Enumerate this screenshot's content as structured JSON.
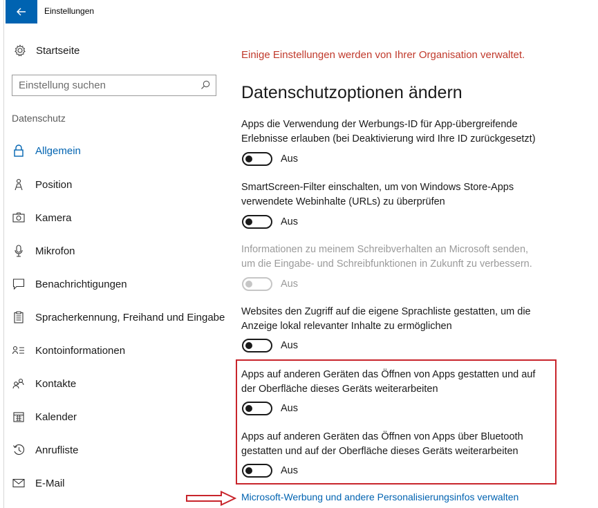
{
  "window": {
    "title": "Einstellungen",
    "back_icon": "back-arrow-icon",
    "accent": "#0063b1"
  },
  "sidebar": {
    "home": {
      "label": "Startseite",
      "icon": "gear-icon"
    },
    "search": {
      "placeholder": "Einstellung suchen",
      "icon": "search-icon"
    },
    "section": "Datenschutz",
    "items": [
      {
        "label": "Allgemein",
        "icon": "lock-icon",
        "active": true
      },
      {
        "label": "Position",
        "icon": "person-location-icon"
      },
      {
        "label": "Kamera",
        "icon": "camera-icon"
      },
      {
        "label": "Mikrofon",
        "icon": "microphone-icon"
      },
      {
        "label": "Benachrichtigungen",
        "icon": "notification-icon"
      },
      {
        "label": "Spracherkennung, Freihand und Eingabe",
        "icon": "clipboard-icon"
      },
      {
        "label": "Kontoinformationen",
        "icon": "account-info-icon"
      },
      {
        "label": "Kontakte",
        "icon": "contacts-icon"
      },
      {
        "label": "Kalender",
        "icon": "calendar-icon"
      },
      {
        "label": "Anrufliste",
        "icon": "call-history-icon"
      },
      {
        "label": "E-Mail",
        "icon": "mail-icon"
      }
    ]
  },
  "main": {
    "org_notice": "Einige Einstellungen werden von Ihrer Organisation verwaltet.",
    "org_notice_color": "#c0392b",
    "heading": "Datenschutzoptionen ändern",
    "settings": [
      {
        "line1": "Apps die Verwendung der Werbungs-ID für App-übergreifende",
        "line2": "Erlebnisse erlauben (bei Deaktivierung wird Ihre ID zurückgesetzt)",
        "state": "Aus",
        "enabled": true
      },
      {
        "line1": "SmartScreen-Filter einschalten, um von Windows Store-Apps",
        "line2": "verwendete Webinhalte (URLs) zu überprüfen",
        "state": "Aus",
        "enabled": true
      },
      {
        "line1": "Informationen zu meinem Schreibverhalten an Microsoft senden,",
        "line2": "um die Eingabe- und Schreibfunktionen in Zukunft zu verbessern.",
        "state": "Aus",
        "enabled": false
      },
      {
        "line1": "Websites den Zugriff auf die eigene Sprachliste gestatten, um die",
        "line2": "Anzeige lokal relevanter Inhalte zu ermöglichen",
        "state": "Aus",
        "enabled": true
      },
      {
        "line1": "Apps auf anderen Geräten das Öffnen von Apps gestatten und auf",
        "line2": "der Oberfläche dieses Geräts weiterarbeiten",
        "state": "Aus",
        "enabled": true
      },
      {
        "line1": "Apps auf anderen Geräten das Öffnen von Apps über Bluetooth",
        "line2": "gestatten und auf der Oberfläche dieses Geräts weiterarbeiten",
        "state": "Aus",
        "enabled": true
      }
    ],
    "link": "Microsoft-Werbung und andere Personalisierungsinfos verwalten",
    "annotation_color": "#c8242b"
  }
}
